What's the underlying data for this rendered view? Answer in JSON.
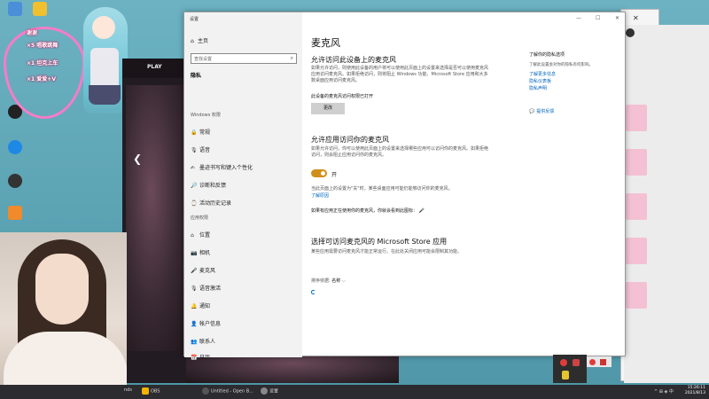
{
  "desktop": {
    "icons": [
      {
        "label": "",
        "color": "#4a8fd8"
      },
      {
        "label": "",
        "color": "#f0c030"
      },
      {
        "label": "",
        "color": "#2a6edb"
      },
      {
        "label": "",
        "color": "#d8d8d8"
      },
      {
        "label": "",
        "color": "#1e88e5"
      },
      {
        "label": "",
        "color": "#333333"
      },
      {
        "label": "",
        "color": "#f08a2a"
      }
    ]
  },
  "sticker": {
    "line1": "谢谢",
    "line2": "×5 唱歌跳舞",
    "line3": "×1 坦克上车",
    "line4": "×1 爱爱+V"
  },
  "game": {
    "play_label": "PLAY",
    "arrow": "❮"
  },
  "window": {
    "title": "设置",
    "min": "—",
    "max": "☐",
    "close": "✕"
  },
  "nav": {
    "home": "主页",
    "search_placeholder": "查找设置",
    "current": "隐私",
    "section_windows": "Windows 权限",
    "windows_items": [
      {
        "icon": "🔒",
        "label": "常规"
      },
      {
        "icon": "🎙",
        "label": "语音"
      },
      {
        "icon": "✍",
        "label": "墨迹书写和键入个性化"
      },
      {
        "icon": "🔎",
        "label": "诊断和反馈"
      },
      {
        "icon": "⌚",
        "label": "活动历史记录"
      }
    ],
    "section_app": "应用权限",
    "app_items": [
      {
        "icon": "⌂",
        "label": "位置"
      },
      {
        "icon": "📷",
        "label": "相机"
      },
      {
        "icon": "🎤",
        "label": "麦克风"
      },
      {
        "icon": "🎙",
        "label": "语音激活"
      },
      {
        "icon": "🔔",
        "label": "通知"
      },
      {
        "icon": "👤",
        "label": "帐户信息"
      },
      {
        "icon": "👥",
        "label": "联系人"
      },
      {
        "icon": "📅",
        "label": "日历"
      }
    ]
  },
  "content": {
    "title": "麦克风",
    "section1": {
      "heading": "允许访问此设备上的麦克风",
      "desc": "如果允许访问，则使用此设备的用户将可以使用此页面上的设置来选择是否可以使用麦克风应用访问麦克风。如果拒绝访问，则将阻止 Windows 功能、Microsoft Store 应用和大多数桌面应用访问麦克风。",
      "status": "此设备的麦克风访问权限已打开",
      "button": "更改"
    },
    "section2": {
      "heading": "允许应用访问你的麦克风",
      "desc": "如果允许访问，你可以使用此页面上的设置来选择哪些应用可以访问你的麦克风。如果拒绝访问，则会阻止应用访问你的麦克风。",
      "toggle_label": "开",
      "toggle_on": true,
      "note": "当此页面上的设置为\"关\"时，某些桌面应用可能仍能够访问你的麦克风。",
      "learn_more": "了解原因",
      "inuse_note": "如果有应用正在使用你的麦克风，你就会看到此图标："
    },
    "section3": {
      "heading": "选择可访问麦克风的 Microsoft Store 应用",
      "desc": "某些应用需要访问麦克风才能正常运行。在此处关闭应用可能会限制其功能。",
      "sort_prefix": "排序依据:",
      "sort_value": "名称",
      "sort_chevron": "⌵"
    },
    "side": {
      "title": "了解你的隐私选项",
      "subtitle": "了解此设置会对你的隐私有何影响。",
      "links": [
        "了解更多信息",
        "隐私仪表板",
        "隐私声明"
      ],
      "feedback": "提供反馈"
    }
  },
  "taskbar": {
    "tasks": [
      {
        "label": "nds",
        "color": "#e0e0e0"
      },
      {
        "label": "OBS",
        "color": "#f2b400"
      },
      {
        "label": "Untitled - Open B...",
        "color": "#555555"
      },
      {
        "label": "设置",
        "color": "#888888"
      }
    ],
    "time": "15:26:11",
    "date": "2021/8/13",
    "tray_text": "^ ⊞ ◈ 中"
  }
}
